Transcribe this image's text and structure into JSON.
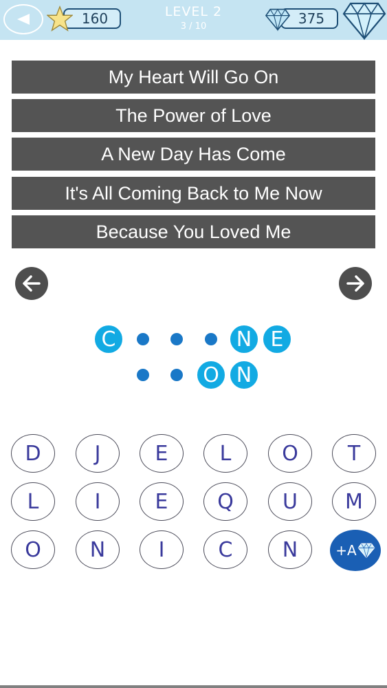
{
  "header": {
    "stars": "160",
    "level_title": "LEVEL 2",
    "level_progress": "3 / 10",
    "diamonds": "375"
  },
  "clues": [
    "My Heart Will Go On",
    "The Power of Love",
    "A New Day Has Come",
    "It's All Coming Back to Me Now",
    "Because You Loved Me"
  ],
  "answer": {
    "row1": [
      "C",
      "",
      "",
      "",
      "N",
      "E"
    ],
    "row2": [
      "",
      "",
      "O",
      "N"
    ]
  },
  "keyboard": [
    [
      "D",
      "J",
      "E",
      "L",
      "O",
      "T"
    ],
    [
      "L",
      "I",
      "E",
      "Q",
      "U",
      "M"
    ],
    [
      "O",
      "N",
      "I",
      "C",
      "N"
    ]
  ],
  "hint_button": "+A",
  "icons": {
    "back": "back-triangle-icon",
    "star": "star-icon",
    "diamond": "diamond-icon",
    "prev": "arrow-left-icon",
    "next": "arrow-right-icon"
  },
  "colors": {
    "topbar": "#c5e4f2",
    "clue_bg": "#545454",
    "slot_filled": "#12aae3",
    "slot_empty": "#1a78c7",
    "key_text": "#3a3a9c",
    "hint_button": "#1a5fb4"
  }
}
